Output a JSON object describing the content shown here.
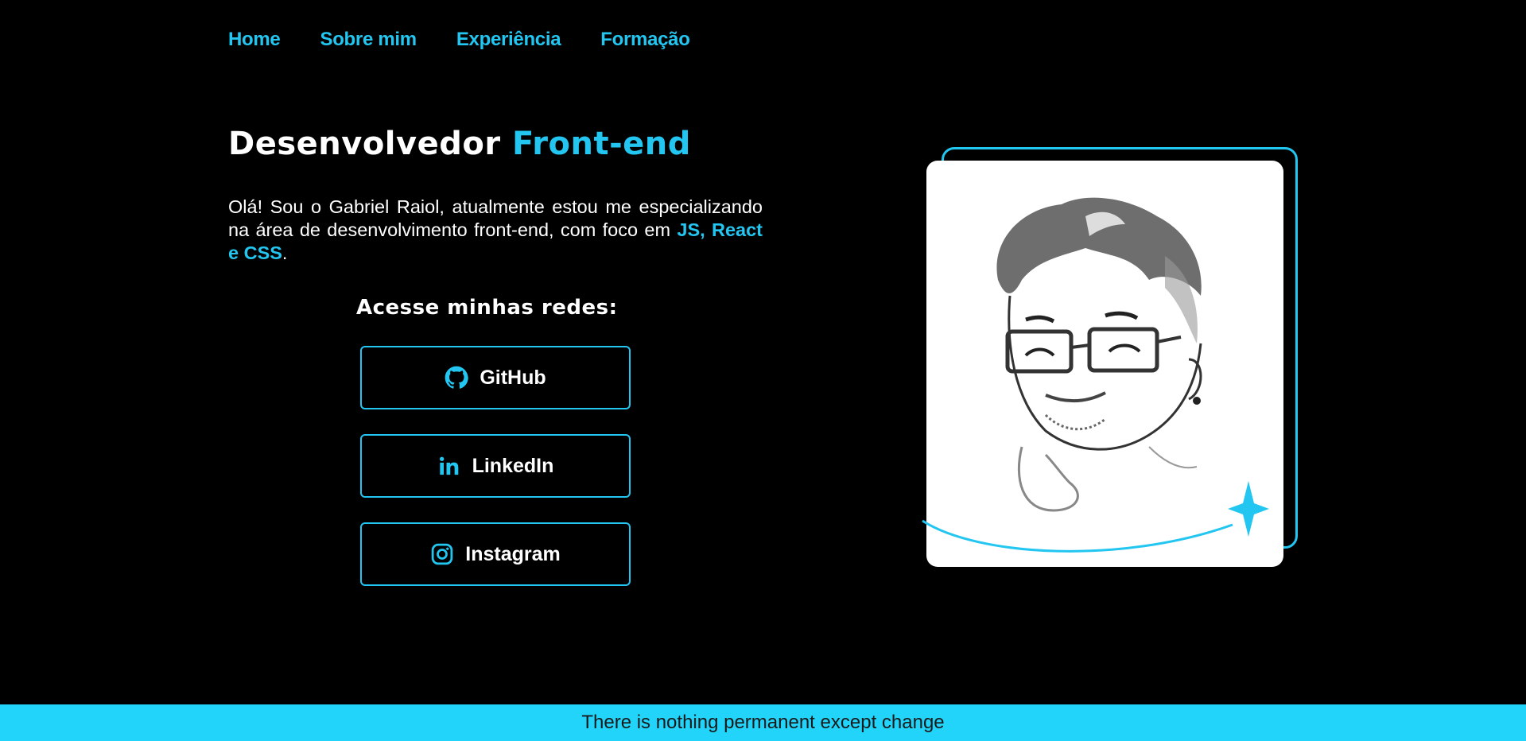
{
  "nav": {
    "items": [
      {
        "label": "Home"
      },
      {
        "label": "Sobre mim"
      },
      {
        "label": "Experiência"
      },
      {
        "label": "Formação"
      }
    ]
  },
  "hero": {
    "title_part1": "Desenvolvedor",
    "title_accent": "Front-end",
    "intro_text": "Olá! Sou o Gabriel Raiol, atualmente estou me especializando na área de desenvolvimento front-end, com foco em",
    "intro_accent": "JS, React e CSS",
    "intro_end": "."
  },
  "social": {
    "title": "Acesse minhas redes:",
    "buttons": [
      {
        "label": "GitHub",
        "icon": "github-icon"
      },
      {
        "label": "LinkedIn",
        "icon": "linkedin-icon"
      },
      {
        "label": "Instagram",
        "icon": "instagram-icon"
      }
    ]
  },
  "portrait": {
    "image": "caricature-illustration"
  },
  "footer": {
    "quote": "There is nothing permanent except change"
  },
  "colors": {
    "accent": "#22c6f0",
    "footer_bg": "#22d3fa",
    "background": "#000000"
  }
}
